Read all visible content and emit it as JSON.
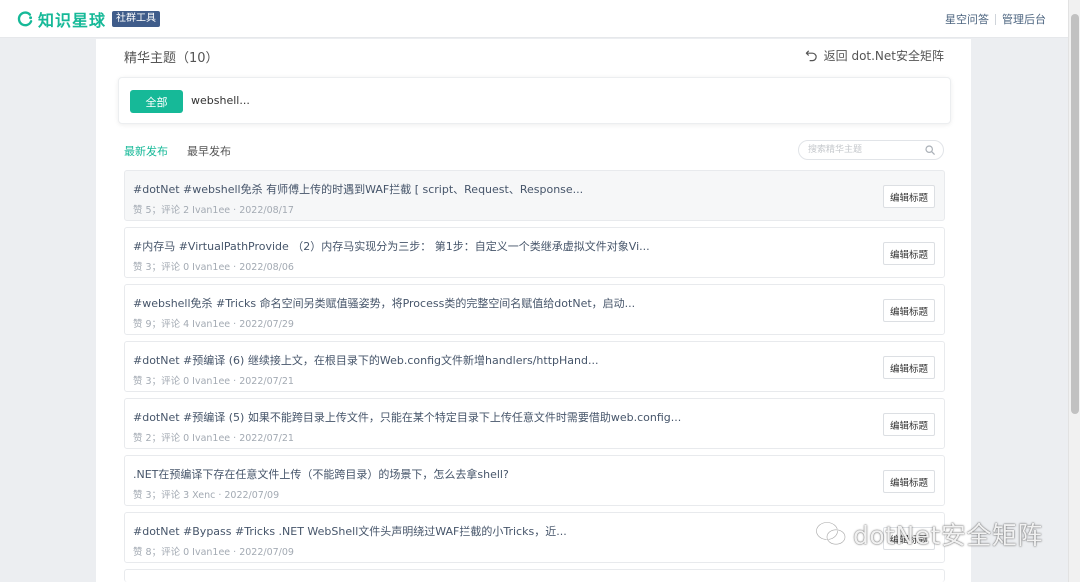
{
  "header": {
    "logo_text": "知识星球",
    "logo_badge": "社群工具",
    "links": [
      "星空问答",
      "管理后台"
    ],
    "brand_color": "#16b998"
  },
  "page": {
    "title": "精华主题（10）",
    "back_label": "返回 dot.Net安全矩阵"
  },
  "filter": {
    "all_label": "全部",
    "tag": "webshell..."
  },
  "sort": {
    "latest": "最新发布",
    "earliest": "最早发布"
  },
  "search": {
    "placeholder": "搜索精华主题"
  },
  "topics": [
    {
      "title": "#dotNet #webshell免杀 有师傅上传的时遇到WAF拦截 [ script、Request、Response...",
      "meta": "赞 5；评论 2    Ivan1ee · 2022/08/17",
      "edit_label": "编辑标题"
    },
    {
      "title": "#内存马 #VirtualPathProvide （2）内存马实现分为三步： 第1步：自定义一个类继承虚拟文件对象Vi...",
      "meta": "赞 3；评论 0    Ivan1ee · 2022/08/06",
      "edit_label": "编辑标题"
    },
    {
      "title": "#webshell免杀 #Tricks 命名空间另类赋值骚姿势，将Process类的完整空间名赋值给dotNet，启动...",
      "meta": "赞 9；评论 4    Ivan1ee · 2022/07/29",
      "edit_label": "编辑标题"
    },
    {
      "title": "#dotNet #预编译 (6) 继续接上文，在根目录下的Web.config文件新增handlers/httpHand...",
      "meta": "赞 3；评论 0    Ivan1ee · 2022/07/21",
      "edit_label": "编辑标题"
    },
    {
      "title": "#dotNet #预编译 (5)  如果不能跨目录上传文件，只能在某个特定目录下上传任意文件时需要借助web.config...",
      "meta": "赞 2；评论 0    Ivan1ee · 2022/07/21",
      "edit_label": "编辑标题"
    },
    {
      "title": ".NET在预编译下存在任意文件上传（不能跨目录）的场景下，怎么去拿shell?",
      "meta": "赞 3；评论 3    Xenc · 2022/07/09",
      "edit_label": "编辑标题"
    },
    {
      "title": "#dotNet #Bypass #Tricks .NET WebShell文件头声明绕过WAF拦截的小Tricks，近...",
      "meta": "赞 8；评论 0    Ivan1ee · 2022/07/09",
      "edit_label": "编辑标题"
    }
  ],
  "watermark": {
    "text": "dotNet安全矩阵",
    "icon": "wechat-icon"
  }
}
